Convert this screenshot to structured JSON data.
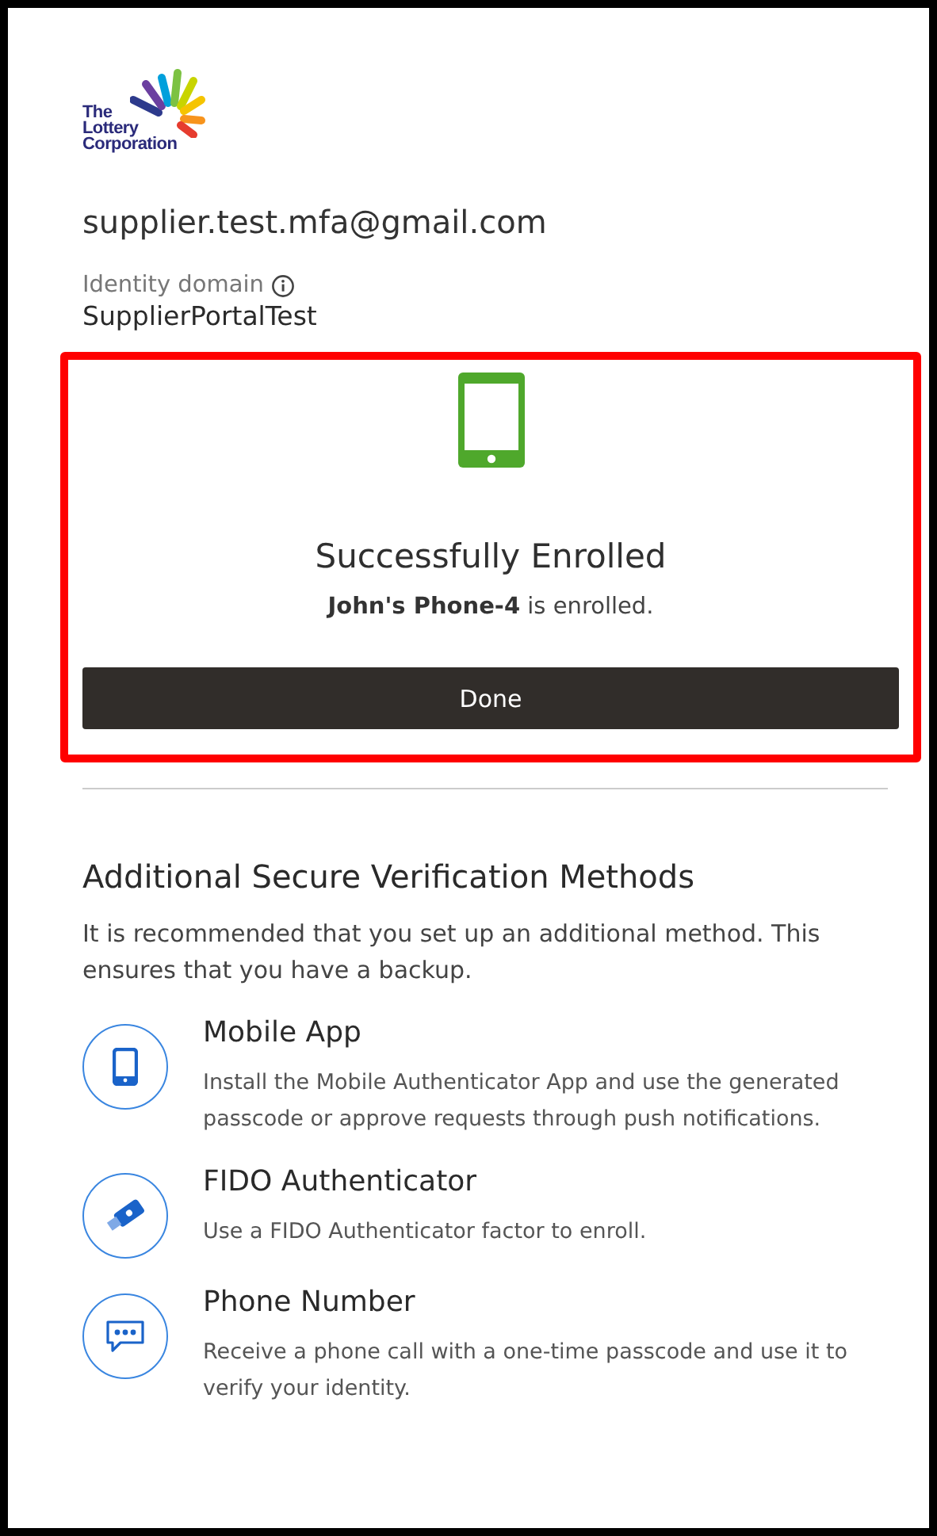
{
  "logo": {
    "lines": [
      "The",
      "Lottery",
      "Corporation"
    ]
  },
  "user": {
    "email": "supplier.test.mfa@gmail.com",
    "domain_label": "Identity domain",
    "domain": "SupplierPortalTest"
  },
  "success": {
    "title": "Successfully Enrolled",
    "message": "**John's Phone-4** is enrolled.",
    "button": "Done"
  },
  "additional": {
    "heading": "Additional Secure Verification Methods",
    "intro": "It is recommended that you set up an additional method. This ensures that you have a backup.",
    "methods": [
      {
        "kind": "mobile",
        "title": "Mobile App",
        "description": "Install the Mobile Authenticator App and use the generated passcode or approve requests through push notifications."
      },
      {
        "kind": "fido",
        "title": "FIDO Authenticator",
        "description": "Use a FIDO Authenticator factor to enroll."
      },
      {
        "kind": "phone",
        "title": "Phone Number",
        "description": "Receive a phone call with a one-time passcode and use it to verify your identity."
      }
    ]
  }
}
